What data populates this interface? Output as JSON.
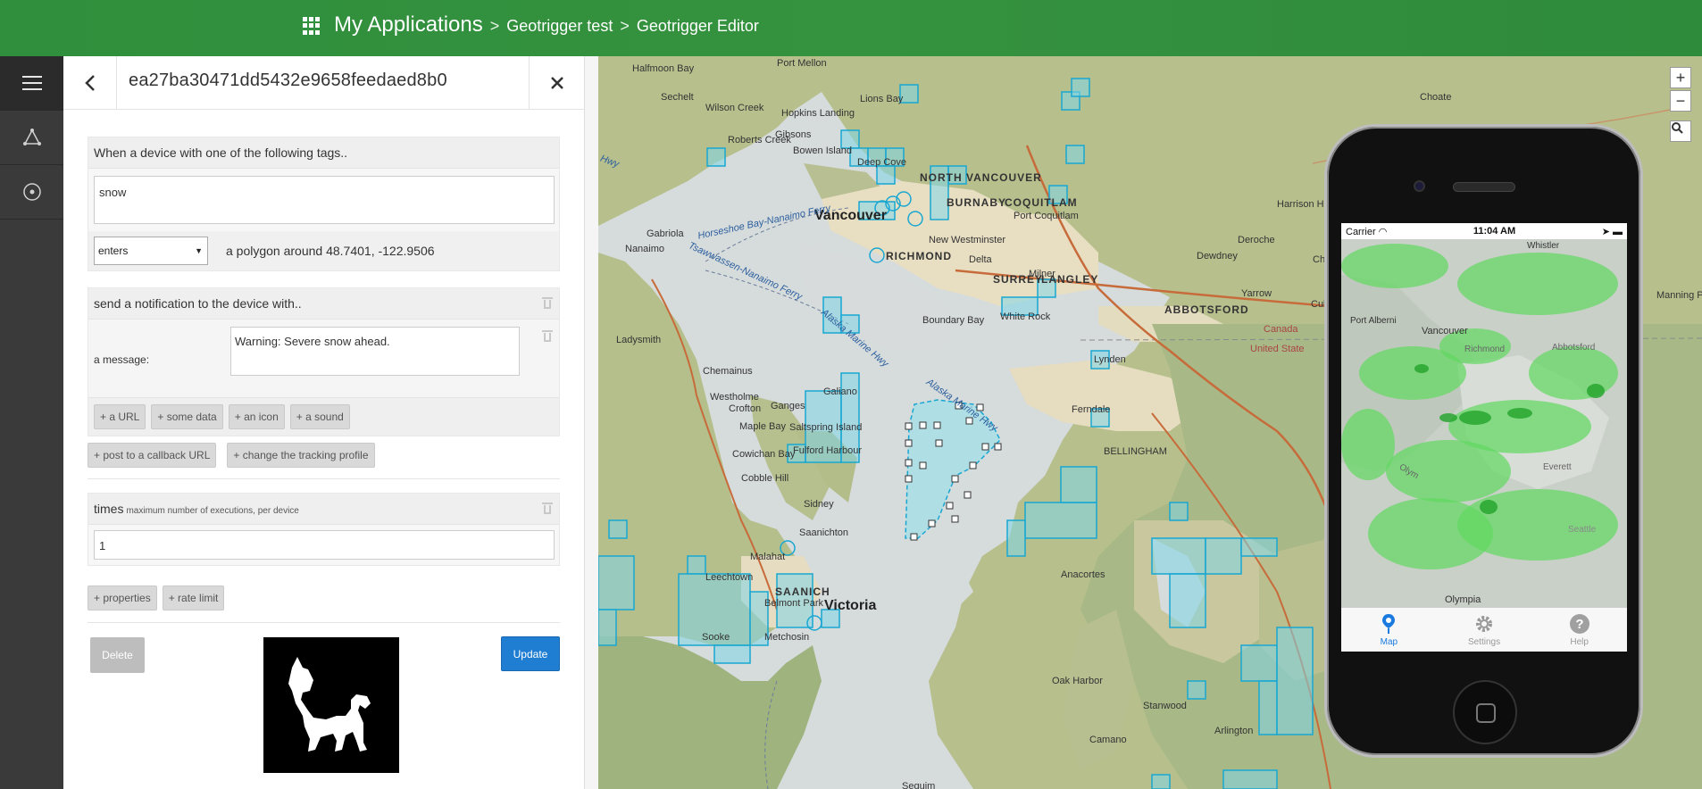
{
  "header": {
    "app_title": "My Applications",
    "sep": ">",
    "crumb1": "Geotrigger test",
    "crumb2": "Geotrigger Editor"
  },
  "panel": {
    "title": "ea27ba30471dd5432e9658feedaed8b0",
    "back_icon": "‹",
    "close_icon": "✕"
  },
  "condition": {
    "label": "When a device with one of the following tags..",
    "tag_value": "snow",
    "direction": "enters",
    "shape_text": "a polygon around 48.7401, -122.9506"
  },
  "action": {
    "label": "send a notification to the device with..",
    "message_label": "a message:",
    "message_value": "Warning: Severe snow ahead.",
    "chips": [
      "+ a URL",
      "+ some data",
      "+ an icon",
      "+ a sound"
    ]
  },
  "extra_actions": [
    "+ post to a callback URL",
    "+ change the tracking profile"
  ],
  "times": {
    "label": "times",
    "hint": "maximum number of executions, per device",
    "value": "1"
  },
  "extra_props": [
    "+ properties",
    "+ rate limit"
  ],
  "buttons": {
    "delete": "Delete",
    "update": "Update"
  },
  "map": {
    "zoom_in": "+",
    "zoom_out": "−",
    "labels": {
      "vancouver": "Vancouver",
      "victoria": "Victoria",
      "north_vancouver": "NORTH VANCOUVER",
      "burnaby": "BURNABY",
      "coquitlam": "COQUITLAM",
      "port_coquitlam": "Port Coquitlam",
      "richmond": "RICHMOND",
      "new_westminster": "New Westminster",
      "delta": "Delta",
      "surrey": "SURREY",
      "langley": "LANGLEY",
      "white_rock": "White Rock",
      "abbotsford": "ABBOTSFORD",
      "boundary_bay": "Boundary Bay",
      "bellingham": "BELLINGHAM",
      "nanaimo": "Nanaimo",
      "gabriola": "Gabriola",
      "ladysmith": "Ladysmith",
      "chemainus": "Chemainus",
      "saanichton": "Saanichton",
      "sidney": "Sidney",
      "saanich": "SAANICH",
      "sooke": "Sooke",
      "metchosin": "Metchosin",
      "anacortes": "Anacortes",
      "ferndale": "Ferndale",
      "lynden": "Lynden",
      "chilliwack": "Chilliwa",
      "cultus_lake": "Cultus Lake",
      "yarrow": "Yarrow",
      "harrison": "Harrison Hot",
      "half_moon_bay": "Halfmoon Bay",
      "sechelt": "Sechelt",
      "wilson_creek": "Wilson Creek",
      "roberts_creek": "Roberts Creek",
      "gibsons": "Gibsons",
      "bowen": "Bowen Island",
      "hopkins": "Hopkins Landing",
      "lions_bay": "Lions Bay",
      "port_mellon": "Port Mellon",
      "galiano": "Galiano",
      "ganges": "Ganges",
      "saltspring": "Saltspring Island",
      "fulford": "Fulford Harbour",
      "maple_bay": "Maple Bay",
      "cowichan": "Cowichan Bay",
      "cobble_hill": "Cobble Hill",
      "crofton": "Crofton",
      "westholme": "Westholme",
      "malahat": "Malahat",
      "leechtown": "Leechtown",
      "belmont": "Belmont Park",
      "camano": "Camano",
      "oak_harbor": "Oak Harbor",
      "stanwood": "Stanwood",
      "arlington": "Arlington",
      "dewdney": "Dewdney",
      "deroche": "Deroche",
      "milner": "Milner",
      "choate": "Choate",
      "manning": "Manning Park",
      "canada": "Canada",
      "united_states": "United State",
      "horseshoe_ferry": "Horseshoe Bay-Nanaimo Ferry",
      "tsawwassen_ferry": "Tsawwassen-Nanaimo Ferry",
      "alaska_hwy1": "Alaska Marine Hwy",
      "alaska_hwy2": "Alaska Marine Hwy",
      "hwy": "Hwy",
      "deep_cove": "Deep Cove",
      "sequim": "Sequim"
    }
  },
  "phone": {
    "carrier": "Carrier",
    "time": "11:04 AM",
    "tabs": [
      "Map",
      "Settings",
      "Help"
    ],
    "map_labels": {
      "whistler": "Whistler",
      "port_alberni": "Port Alberni",
      "vancouver": "Vancouver",
      "richmond": "Richmond",
      "abbotsford": "Abbotsford",
      "everett": "Everett",
      "seattle": "Seattle",
      "olympia": "Olympia",
      "olympic": "Olym"
    }
  },
  "colors": {
    "header_green": "#2f8f3c",
    "geofence_fill": "#7fd6e8",
    "geofence_stroke": "#19a7d1",
    "update_blue": "#1f7ed2"
  }
}
